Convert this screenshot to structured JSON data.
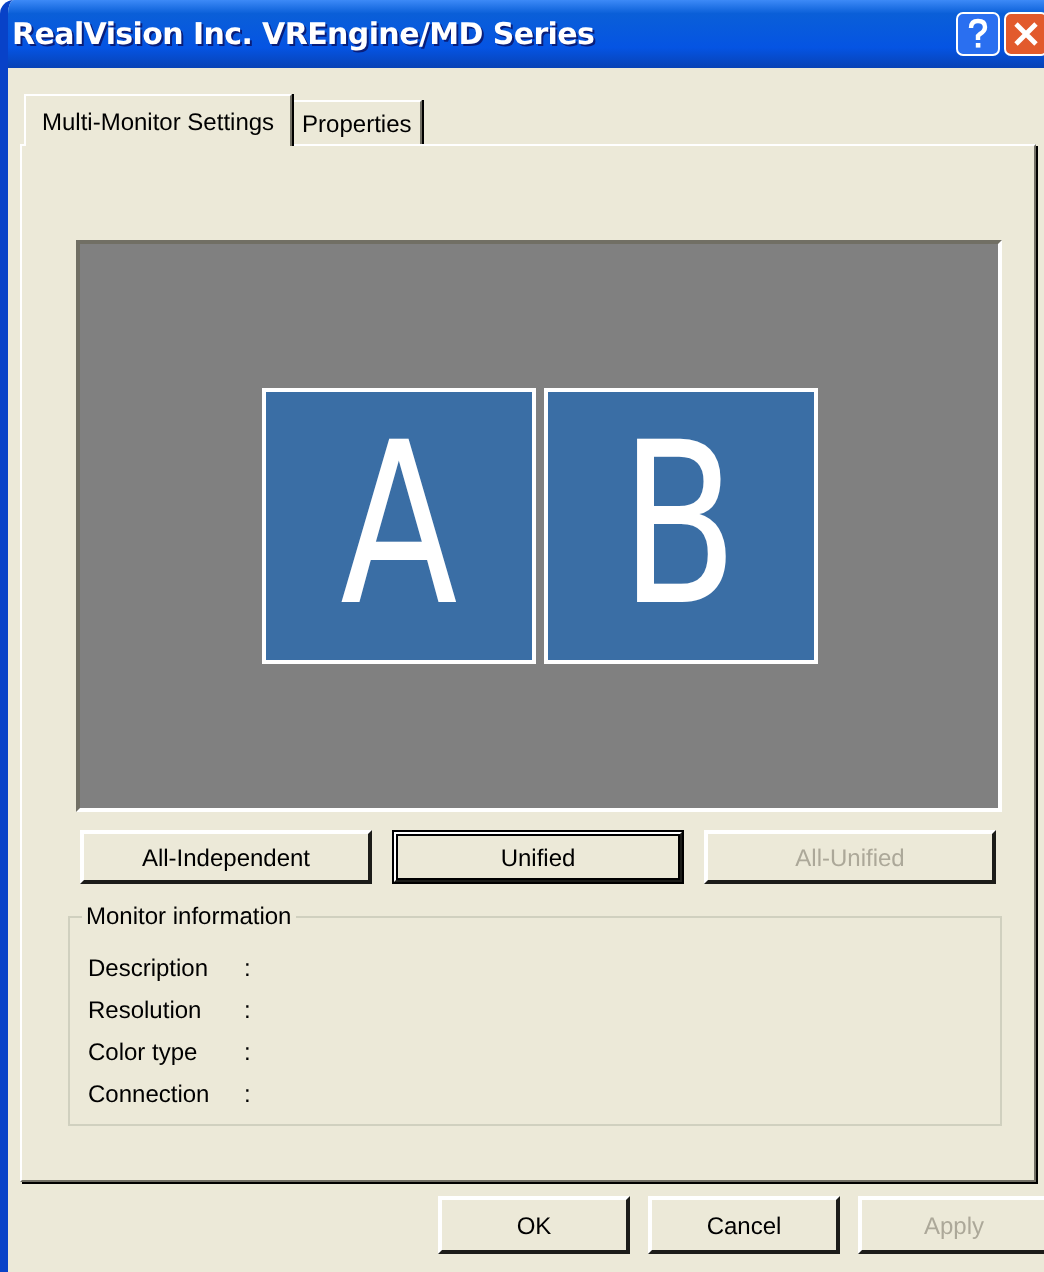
{
  "window": {
    "title": "RealVision Inc. VREngine/MD Series"
  },
  "tabs": [
    {
      "label": "Multi-Monitor Settings",
      "selected": true
    },
    {
      "label": "Properties",
      "selected": false
    }
  ],
  "monitors": [
    {
      "label": "A"
    },
    {
      "label": "B"
    }
  ],
  "mode_buttons": [
    {
      "label": "All-Independent",
      "default": false,
      "disabled": false
    },
    {
      "label": "Unified",
      "default": true,
      "disabled": false
    },
    {
      "label": "All-Unified",
      "default": false,
      "disabled": true
    }
  ],
  "monitor_information": {
    "title": "Monitor information",
    "rows": [
      {
        "label": "Description",
        "separator": ":"
      },
      {
        "label": "Resolution",
        "separator": ":"
      },
      {
        "label": "Color type",
        "separator": ":"
      },
      {
        "label": "Connection",
        "separator": ":"
      }
    ]
  },
  "buttons": [
    {
      "label": "OK",
      "disabled": false
    },
    {
      "label": "Cancel",
      "disabled": false
    },
    {
      "label": "Apply",
      "disabled": true
    }
  ]
}
